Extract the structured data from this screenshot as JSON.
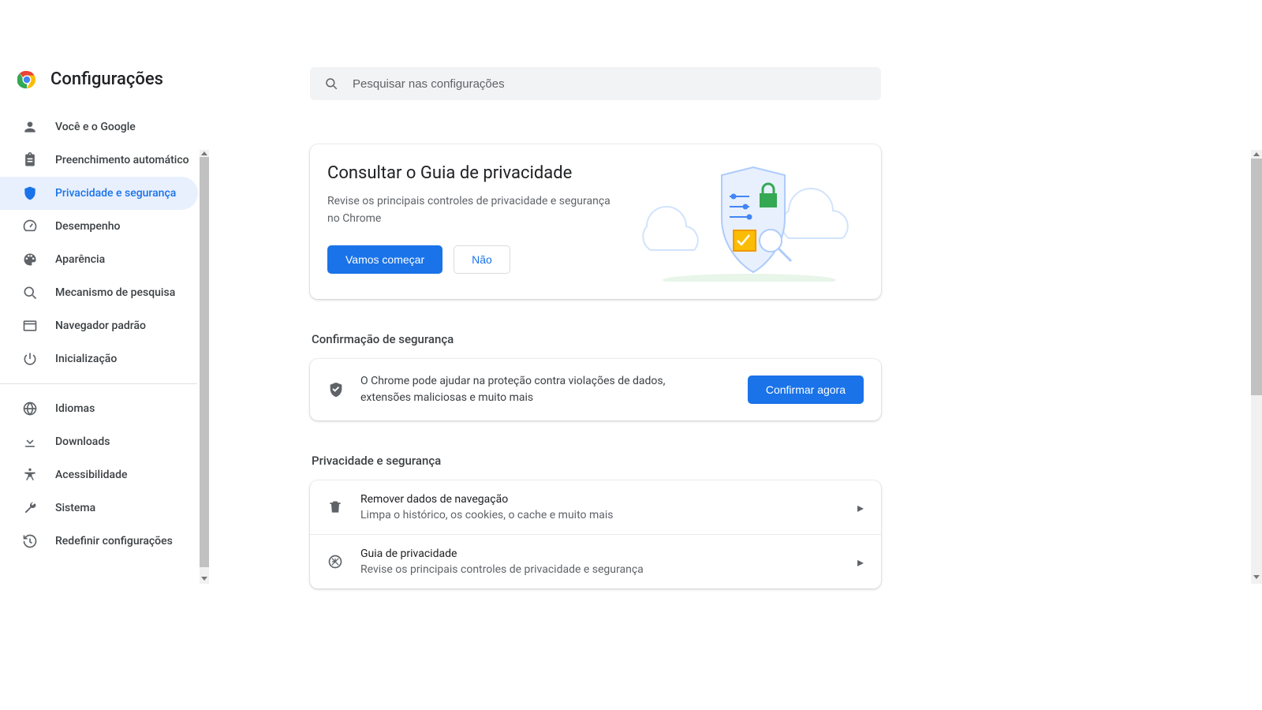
{
  "header": {
    "title": "Configurações"
  },
  "search": {
    "placeholder": "Pesquisar nas configurações"
  },
  "sidebar": {
    "items": [
      {
        "label": "Você e o Google"
      },
      {
        "label": "Preenchimento automático"
      },
      {
        "label": "Privacidade e segurança"
      },
      {
        "label": "Desempenho"
      },
      {
        "label": "Aparência"
      },
      {
        "label": "Mecanismo de pesquisa"
      },
      {
        "label": "Navegador padrão"
      },
      {
        "label": "Inicialização"
      }
    ],
    "items2": [
      {
        "label": "Idiomas"
      },
      {
        "label": "Downloads"
      },
      {
        "label": "Acessibilidade"
      },
      {
        "label": "Sistema"
      },
      {
        "label": "Redefinir configurações"
      }
    ]
  },
  "guide": {
    "title": "Consultar o Guia de privacidade",
    "desc": "Revise os principais controles de privacidade e segurança no Chrome",
    "primary": "Vamos começar",
    "secondary": "Não"
  },
  "safety": {
    "section": "Confirmação de segurança",
    "text": "O Chrome pode ajudar na proteção contra violações de dados, extensões maliciosas e muito mais",
    "button": "Confirmar agora"
  },
  "privacy": {
    "section": "Privacidade e segurança",
    "rows": [
      {
        "title": "Remover dados de navegação",
        "sub": "Limpa o histórico, os cookies, o cache e muito mais"
      },
      {
        "title": "Guia de privacidade",
        "sub": "Revise os principais controles de privacidade e segurança"
      }
    ]
  }
}
